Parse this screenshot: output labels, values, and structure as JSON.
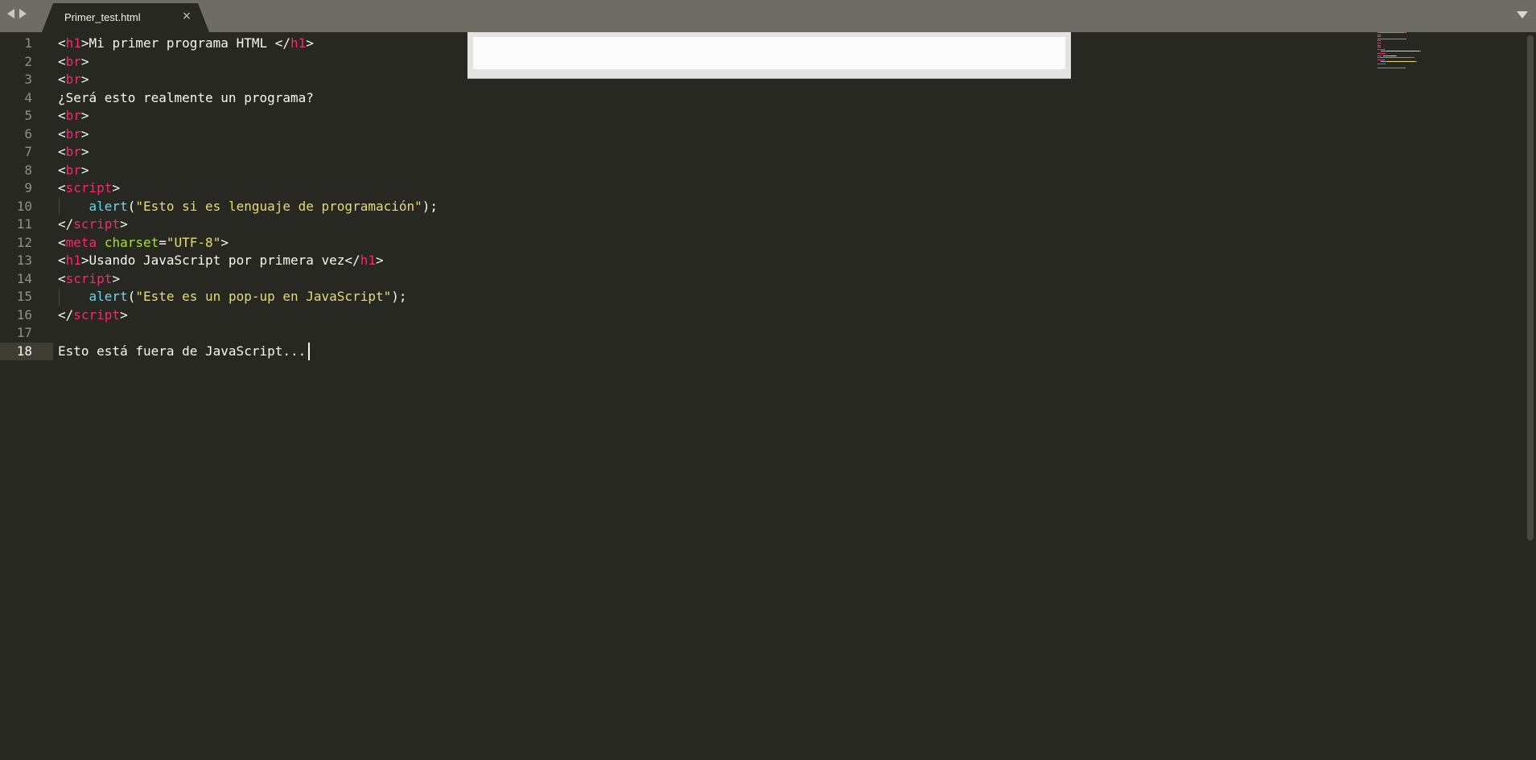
{
  "window": {
    "tab": {
      "label": "Primer_test.html",
      "close_glyph": "×"
    }
  },
  "icons": {
    "nav_back": "arrow-left-icon",
    "nav_forward": "arrow-right-icon",
    "tab_close": "close-icon",
    "tab_menu": "chevron-down-icon"
  },
  "colors": {
    "background": "#272822",
    "tabbar": "#6d6d65",
    "tag": "#f92672",
    "attribute": "#a6e22e",
    "string": "#e6db74",
    "function": "#66d9ef",
    "text": "#f8f8f2",
    "gutter": "#90908a"
  },
  "editor": {
    "active_line": 18,
    "line_numbers": [
      "1",
      "2",
      "3",
      "4",
      "5",
      "6",
      "7",
      "8",
      "9",
      "10",
      "11",
      "12",
      "13",
      "14",
      "15",
      "16",
      "17",
      "18"
    ],
    "lines": [
      [
        {
          "t": "plain",
          "v": "<"
        },
        {
          "t": "tag",
          "v": "h1"
        },
        {
          "t": "plain",
          "v": ">Mi primer programa HTML </"
        },
        {
          "t": "tag",
          "v": "h1"
        },
        {
          "t": "plain",
          "v": ">"
        }
      ],
      [
        {
          "t": "plain",
          "v": "<"
        },
        {
          "t": "tag",
          "v": "br"
        },
        {
          "t": "plain",
          "v": ">"
        }
      ],
      [
        {
          "t": "plain",
          "v": "<"
        },
        {
          "t": "tag",
          "v": "br"
        },
        {
          "t": "plain",
          "v": ">"
        }
      ],
      [
        {
          "t": "plain",
          "v": "¿Será esto realmente un programa?"
        }
      ],
      [
        {
          "t": "plain",
          "v": "<"
        },
        {
          "t": "tag",
          "v": "br"
        },
        {
          "t": "plain",
          "v": ">"
        }
      ],
      [
        {
          "t": "plain",
          "v": "<"
        },
        {
          "t": "tag",
          "v": "br"
        },
        {
          "t": "plain",
          "v": ">"
        }
      ],
      [
        {
          "t": "plain",
          "v": "<"
        },
        {
          "t": "tag",
          "v": "br"
        },
        {
          "t": "plain",
          "v": ">"
        }
      ],
      [
        {
          "t": "plain",
          "v": "<"
        },
        {
          "t": "tag",
          "v": "br"
        },
        {
          "t": "plain",
          "v": ">"
        }
      ],
      [
        {
          "t": "plain",
          "v": "<"
        },
        {
          "t": "tag",
          "v": "script"
        },
        {
          "t": "plain",
          "v": ">"
        }
      ],
      [
        {
          "t": "plain",
          "v": "    "
        },
        {
          "t": "fn",
          "v": "alert"
        },
        {
          "t": "plain",
          "v": "("
        },
        {
          "t": "str",
          "v": "\"Esto si es lenguaje de programación\""
        },
        {
          "t": "plain",
          "v": ");"
        }
      ],
      [
        {
          "t": "plain",
          "v": "</"
        },
        {
          "t": "tag",
          "v": "script"
        },
        {
          "t": "plain",
          "v": ">"
        }
      ],
      [
        {
          "t": "plain",
          "v": "<"
        },
        {
          "t": "tag",
          "v": "meta"
        },
        {
          "t": "plain",
          "v": " "
        },
        {
          "t": "attr",
          "v": "charset"
        },
        {
          "t": "plain",
          "v": "="
        },
        {
          "t": "str",
          "v": "\"UTF-8\""
        },
        {
          "t": "plain",
          "v": ">"
        }
      ],
      [
        {
          "t": "plain",
          "v": "<"
        },
        {
          "t": "tag",
          "v": "h1"
        },
        {
          "t": "plain",
          "v": ">Usando JavaScript por primera vez</"
        },
        {
          "t": "tag",
          "v": "h1"
        },
        {
          "t": "plain",
          "v": ">"
        }
      ],
      [
        {
          "t": "plain",
          "v": "<"
        },
        {
          "t": "tag",
          "v": "script"
        },
        {
          "t": "plain",
          "v": ">"
        }
      ],
      [
        {
          "t": "plain",
          "v": "    "
        },
        {
          "t": "fn",
          "v": "alert"
        },
        {
          "t": "plain",
          "v": "("
        },
        {
          "t": "str",
          "v": "\"Este es un pop-up en JavaScript\""
        },
        {
          "t": "plain",
          "v": ");"
        }
      ],
      [
        {
          "t": "plain",
          "v": "</"
        },
        {
          "t": "tag",
          "v": "script"
        },
        {
          "t": "plain",
          "v": ">"
        }
      ],
      [],
      [
        {
          "t": "plain",
          "v": "Esto está fuera de JavaScript..."
        }
      ]
    ]
  }
}
